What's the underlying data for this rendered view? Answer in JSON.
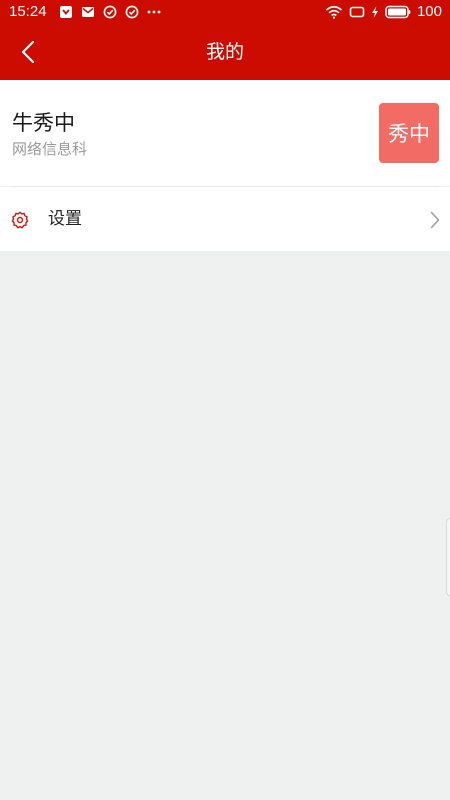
{
  "status_bar": {
    "time": "15:24",
    "battery": "100",
    "icons_left": [
      "download-box-icon",
      "mail-icon",
      "check-circle-icon",
      "check-circle-icon",
      "more-dots-icon"
    ],
    "icons_right": [
      "wifi-icon",
      "screen-icon",
      "charging-icon",
      "battery-icon"
    ]
  },
  "header": {
    "title": "我的",
    "back_icon": "chevron-left-icon"
  },
  "profile": {
    "name": "牛秀中",
    "department": "网络信息科",
    "avatar_text": "秀中"
  },
  "menu": {
    "items": [
      {
        "label": "设置",
        "icon": "gear-icon"
      }
    ]
  },
  "colors": {
    "brand_red": "#cc0c00",
    "avatar_bg": "#f26b64",
    "page_bg": "#eff1f0"
  }
}
